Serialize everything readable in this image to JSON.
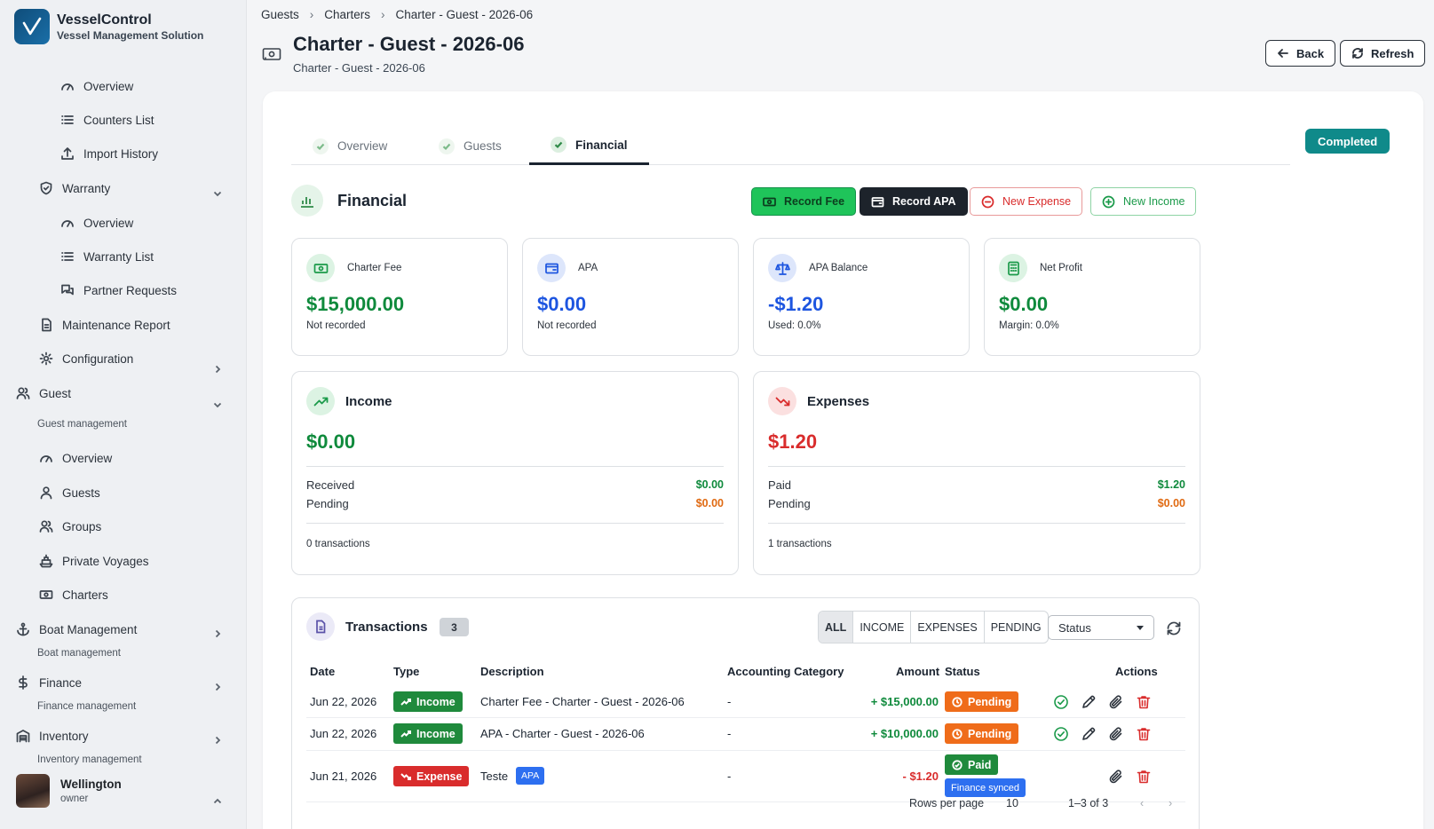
{
  "app": {
    "title": "VesselControl",
    "subtitle": "Vessel Management Solution"
  },
  "sidebar": {
    "items": [
      {
        "label": "Overview"
      },
      {
        "label": "Counters List"
      },
      {
        "label": "Import History"
      },
      {
        "label": "Warranty"
      },
      {
        "label": "Overview"
      },
      {
        "label": "Warranty List"
      },
      {
        "label": "Partner Requests"
      },
      {
        "label": "Maintenance Report"
      },
      {
        "label": "Configuration"
      },
      {
        "label": "Guest",
        "sub": "Guest management"
      },
      {
        "label": "Overview"
      },
      {
        "label": "Guests"
      },
      {
        "label": "Groups"
      },
      {
        "label": "Private Voyages"
      },
      {
        "label": "Charters"
      },
      {
        "label": "Boat Management",
        "sub": "Boat management"
      },
      {
        "label": "Finance",
        "sub": "Finance management"
      },
      {
        "label": "Inventory",
        "sub": "Inventory management"
      }
    ],
    "user": {
      "name": "Wellington",
      "role": "owner"
    }
  },
  "breadcrumb": [
    "Guests",
    "Charters",
    "Charter - Guest - 2026-06"
  ],
  "header": {
    "title": "Charter - Guest - 2026-06",
    "subtitle": "Charter - Guest - 2026-06",
    "back_label": "Back",
    "refresh_label": "Refresh"
  },
  "tabs": [
    {
      "label": "Overview"
    },
    {
      "label": "Guests"
    },
    {
      "label": "Financial"
    }
  ],
  "status": "Completed",
  "financial": {
    "title": "Financial",
    "actions": {
      "record_fee": "Record Fee",
      "record_apa": "Record APA",
      "new_expense": "New Expense",
      "new_income": "New Income"
    },
    "stats": [
      {
        "label": "Charter Fee",
        "value": "$15,000.00",
        "note": "Not recorded"
      },
      {
        "label": "APA",
        "value": "$0.00",
        "note": "Not recorded"
      },
      {
        "label": "APA Balance",
        "value": "-$1.20",
        "note": "Used: 0.0%"
      },
      {
        "label": "Net Profit",
        "value": "$0.00",
        "note": "Margin: 0.0%"
      }
    ],
    "income": {
      "label": "Income",
      "value": "$0.00",
      "row1_label": "Received",
      "row1_value": "$0.00",
      "row2_label": "Pending",
      "row2_value": "$0.00",
      "footer": "0 transactions"
    },
    "expenses": {
      "label": "Expenses",
      "value": "$1.20",
      "row1_label": "Paid",
      "row1_value": "$1.20",
      "row2_label": "Pending",
      "row2_value": "$0.00",
      "footer": "1 transactions"
    }
  },
  "transactions": {
    "title": "Transactions",
    "count": "3",
    "filters": [
      "ALL",
      "INCOME",
      "EXPENSES",
      "PENDING"
    ],
    "status_select": "Status",
    "columns": [
      "Date",
      "Type",
      "Description",
      "Accounting Category",
      "Amount",
      "Status",
      "Actions"
    ],
    "rows": [
      {
        "date": "Jun 22, 2026",
        "type": "Income",
        "description": "Charter Fee - Charter - Guest - 2026-06",
        "category": "-",
        "amount": "+ $15,000.00",
        "status": "Pending"
      },
      {
        "date": "Jun 22, 2026",
        "type": "Income",
        "description": "APA - Charter - Guest - 2026-06",
        "category": "-",
        "amount": "+ $10,000.00",
        "status": "Pending"
      },
      {
        "date": "Jun 21, 2026",
        "type": "Expense",
        "description": "Teste",
        "tag": "APA",
        "category": "-",
        "amount": "- $1.20",
        "status": "Paid",
        "status_extra": "Finance synced"
      }
    ],
    "pager": {
      "rows_label": "Rows per page",
      "rows_value": "10",
      "range": "1–3 of 3"
    }
  },
  "colors": {
    "green": "#0f8a3c",
    "blue": "#1d55e0",
    "red": "#d92c2c",
    "orange": "#ef6c1a",
    "teal": "#0f8a8a"
  }
}
